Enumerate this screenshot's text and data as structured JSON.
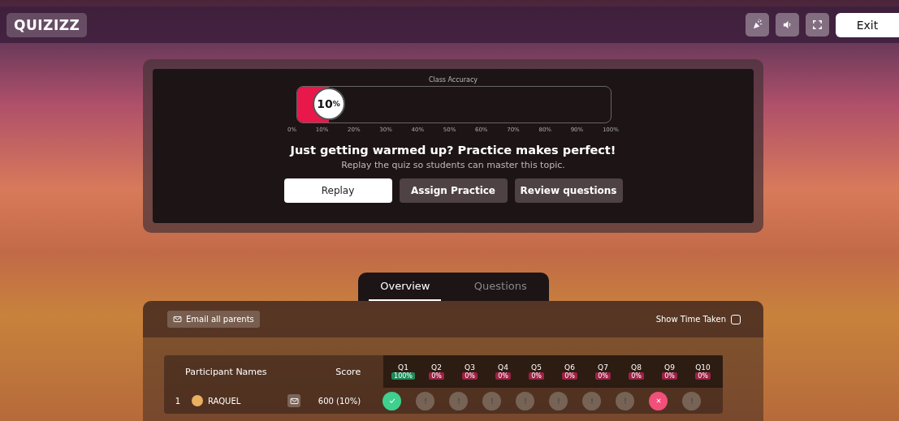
{
  "top_bar": {
    "logo": "QUIZIZZ",
    "tool_buttons": [
      {
        "kind": "confetti"
      },
      {
        "kind": "sound"
      },
      {
        "kind": "fullscreen"
      }
    ],
    "exit_label": "Exit"
  },
  "accuracy": {
    "title": "Class Accuracy",
    "level": 0.1,
    "value": "10",
    "unit": "%",
    "ticks": [
      "0%",
      "10%",
      "20%",
      "30%",
      "40%",
      "50%",
      "60%",
      "70%",
      "80%",
      "90%",
      "100%"
    ]
  },
  "message": {
    "headline": "Just getting warmed up? Practice makes perfect!",
    "subtext": "Replay the quiz so students can master this topic."
  },
  "actions": [
    {
      "label": "Replay",
      "primary": true
    },
    {
      "label": "Assign Practice",
      "primary": false
    },
    {
      "label": "Review questions",
      "primary": false
    }
  ],
  "tabs": [
    {
      "label": "Overview",
      "selected": true
    },
    {
      "label": "Questions",
      "selected": false
    }
  ],
  "toolbar": {
    "email_label": "Email all parents",
    "show_time_label": "Show Time Taken",
    "show_time_checked": false
  },
  "table": {
    "name_header": "Participant Names",
    "score_header": "Score",
    "questions": [
      {
        "label": "Q1",
        "percent": "100%",
        "color": "#1e8a5a"
      },
      {
        "label": "Q2",
        "percent": "0%",
        "color": "#9b2245"
      },
      {
        "label": "Q3",
        "percent": "0%",
        "color": "#9b2245"
      },
      {
        "label": "Q4",
        "percent": "0%",
        "color": "#9b2245"
      },
      {
        "label": "Q5",
        "percent": "0%",
        "color": "#9b2245"
      },
      {
        "label": "Q6",
        "percent": "0%",
        "color": "#9b2245"
      },
      {
        "label": "Q7",
        "percent": "0%",
        "color": "#9b2245"
      },
      {
        "label": "Q8",
        "percent": "0%",
        "color": "#9b2245"
      },
      {
        "label": "Q9",
        "percent": "0%",
        "color": "#9b2245"
      },
      {
        "label": "Q10",
        "percent": "0%",
        "color": "#9b2245"
      }
    ],
    "rows": [
      {
        "rank": "1",
        "name": "RAQUEL",
        "score": "600 (10%)",
        "answers": [
          {
            "kind": "correct"
          },
          {
            "kind": "unattempted"
          },
          {
            "kind": "unattempted"
          },
          {
            "kind": "unattempted"
          },
          {
            "kind": "unattempted"
          },
          {
            "kind": "unattempted"
          },
          {
            "kind": "unattempted"
          },
          {
            "kind": "unattempted"
          },
          {
            "kind": "incorrect"
          },
          {
            "kind": "unattempted"
          }
        ]
      }
    ]
  }
}
